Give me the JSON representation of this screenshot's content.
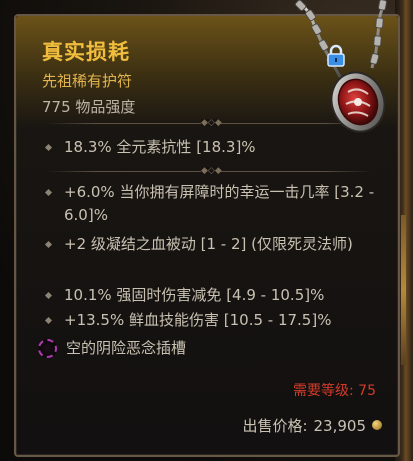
{
  "item": {
    "name": "真实损耗",
    "type": "先祖稀有护符",
    "power": "775 物品强度"
  },
  "implicit_affixes": [
    {
      "text": "18.3% 全元素抗性 [18.3]%"
    }
  ],
  "affixes": [
    {
      "text": "+6.0% 当你拥有屏障时的幸运一击几率 [3.2 - 6.0]%"
    },
    {
      "text": "+2 级凝结之血被动 [1 - 2] (仅限死灵法师)"
    },
    {
      "text": "10.1% 强固时伤害减免 [4.9 - 10.5]%"
    },
    {
      "text": "+13.5% 鲜血技能伤害 [10.5 - 17.5]%"
    }
  ],
  "socket": {
    "text": "空的阴险恶念插槽"
  },
  "requirement": {
    "text": "需要等级: 75"
  },
  "sell": {
    "label": "出售价格:",
    "value": "23,905"
  },
  "icons": {
    "amulet": "amulet-icon",
    "lock": "lock-icon",
    "socket": "empty-socket-icon",
    "gold": "gold-coin-icon"
  },
  "colors": {
    "item_name": "#f0bd3c",
    "item_type": "#e2b44d",
    "requirement": "#d23b2a",
    "socket": "#b23ab4",
    "lock": "#3a8ee6"
  }
}
